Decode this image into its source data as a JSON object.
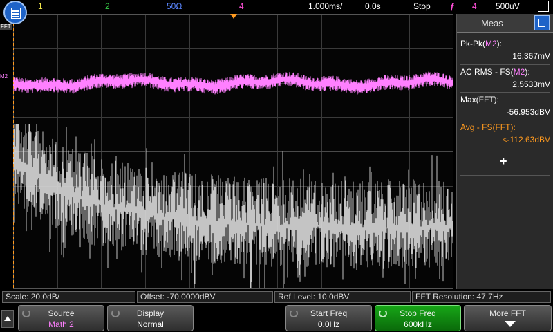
{
  "topbar": {
    "ch1": "1",
    "ch2": "2",
    "impedance": "50Ω",
    "ch4": "4",
    "timebase": "1.000ms/",
    "delay": "0.0s",
    "run_state": "Stop",
    "trigger_source": "4",
    "trigger_level": "500uV"
  },
  "markers": {
    "fft": "FFT",
    "m2": "M2"
  },
  "sidebar": {
    "title": "Meas",
    "measurements": [
      {
        "name_prefix": "Pk-Pk(",
        "name_src": "M2",
        "name_suffix": "):",
        "value": "16.367mV"
      },
      {
        "name_prefix": "AC RMS - FS(",
        "name_src": "M2",
        "name_suffix": "):",
        "value": "2.5533mV"
      },
      {
        "name": "Max(FFT):",
        "value": "-56.953dBV"
      },
      {
        "name": "Avg - FS(FFT):",
        "value": "<-112.63dBV"
      }
    ],
    "add_label": "+"
  },
  "status": {
    "scale": "Scale: 20.0dB/",
    "offset": "Offset: -70.0000dBV",
    "ref_level": "Ref Level: 10.0dBV",
    "fft_resolution": "FFT Resolution: 47.7Hz"
  },
  "softkeys": {
    "source": {
      "title": "Source",
      "value": "Math 2"
    },
    "display": {
      "title": "Display",
      "value": "Normal"
    },
    "start_freq": {
      "title": "Start Freq",
      "value": "0.0Hz"
    },
    "stop_freq": {
      "title": "Stop Freq",
      "value": "600kHz"
    },
    "more": {
      "title": "More FFT"
    }
  },
  "colors": {
    "ch1": "#f2e64b",
    "ch2": "#38d24a",
    "ch3": "#5a86ff",
    "ch4": "#ff4fd8",
    "math": "#ff80ff",
    "fft": "#d9d9d9",
    "cursor": "#ff9a1f",
    "accent": "#1e63c8"
  }
}
